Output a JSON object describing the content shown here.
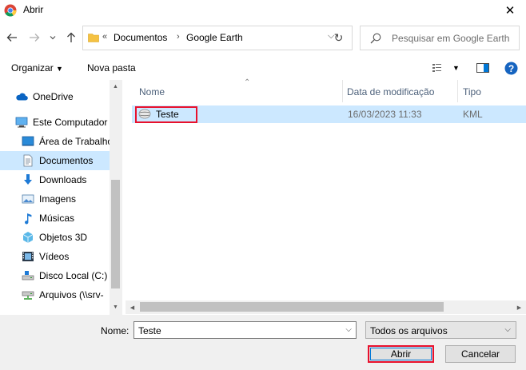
{
  "window": {
    "title": "Abrir",
    "close_glyph": "✕"
  },
  "navigation": {
    "back_icon": "arrow-left",
    "forward_icon": "arrow-right",
    "recent_icon": "chevron-down",
    "up_icon": "arrow-up"
  },
  "address_bar": {
    "overflow_glyph": "«",
    "breadcrumbs": [
      "Documentos",
      "Google Earth"
    ],
    "separator": "›",
    "dropdown_glyph": "⌵",
    "refresh_glyph": "↻"
  },
  "search": {
    "placeholder": "Pesquisar em Google Earth"
  },
  "toolbar": {
    "organize_label": "Organizar",
    "new_folder_label": "Nova pasta",
    "help_glyph": "?"
  },
  "sidebar": {
    "items": [
      {
        "label": "OneDrive",
        "icon": "cloud-icon"
      },
      {
        "label": "Este Computador",
        "icon": "computer-icon"
      },
      {
        "label": "Área de Trabalho",
        "icon": "desktop-icon"
      },
      {
        "label": "Documentos",
        "icon": "documents-icon",
        "selected": true
      },
      {
        "label": "Downloads",
        "icon": "download-icon"
      },
      {
        "label": "Imagens",
        "icon": "pictures-icon"
      },
      {
        "label": "Músicas",
        "icon": "music-icon"
      },
      {
        "label": "Objetos 3D",
        "icon": "cube-icon"
      },
      {
        "label": "Vídeos",
        "icon": "video-icon"
      },
      {
        "label": "Disco Local (C:)",
        "icon": "drive-icon"
      },
      {
        "label": "Arquivos (\\\\srv-",
        "icon": "network-drive-icon"
      }
    ]
  },
  "file_list": {
    "columns": [
      "Nome",
      "Data de modificação",
      "Tipo"
    ],
    "rows": [
      {
        "name": "Teste",
        "modified": "16/03/2023 11:33",
        "type": "KML",
        "selected": true
      }
    ]
  },
  "footer": {
    "filename_label": "Nome:",
    "filename_value": "Teste",
    "filetype_value": "Todos os arquivos",
    "open_label": "Abrir",
    "cancel_label": "Cancelar"
  },
  "colors": {
    "selection": "#cce8ff",
    "highlight_box": "#e8112d",
    "folder": "#f5c242",
    "accent": "#0078d7"
  }
}
